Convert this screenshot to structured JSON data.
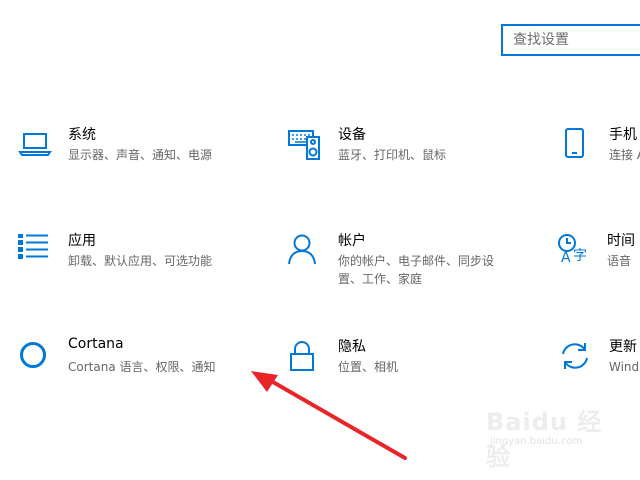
{
  "search": {
    "placeholder": "查找设置"
  },
  "tiles": [
    {
      "icon": "laptop-icon",
      "title": "系统",
      "desc": "显示器、声音、通知、电源"
    },
    {
      "icon": "keyboard-speaker-icon",
      "title": "设备",
      "desc": "蓝牙、打印机、鼠标"
    },
    {
      "icon": "phone-icon",
      "title": "手机",
      "desc": "连接 A"
    },
    {
      "icon": "apps-list-icon",
      "title": "应用",
      "desc": "卸载、默认应用、可选功能"
    },
    {
      "icon": "person-icon",
      "title": "帐户",
      "desc": "你的帐户、电子邮件、同步设置、工作、家庭"
    },
    {
      "icon": "time-language-icon",
      "title": "时间",
      "desc": "语音"
    },
    {
      "icon": "cortana-circle-icon",
      "title": "Cortana",
      "desc": "Cortana 语言、权限、通知"
    },
    {
      "icon": "lock-icon",
      "title": "隐私",
      "desc": "位置、相机"
    },
    {
      "icon": "update-arrows-icon",
      "title": "更新",
      "desc": "Wind"
    }
  ],
  "watermark": {
    "main": "Baidu 经验",
    "sub": "jingyan.baidu.com"
  },
  "colors": {
    "accent": "#0078d7",
    "annotation_arrow": "#e8262a"
  }
}
